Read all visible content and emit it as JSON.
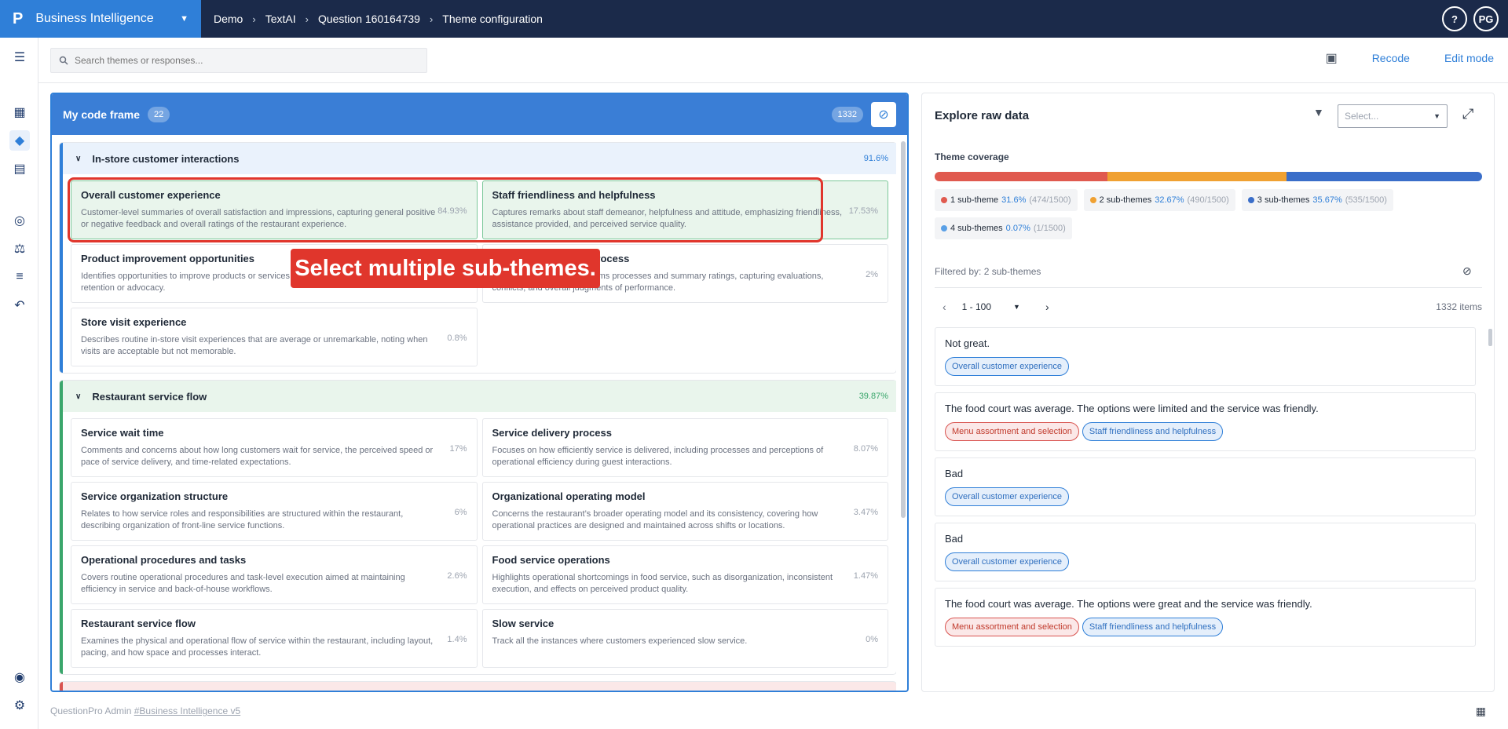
{
  "app": {
    "logo": "P",
    "name": "Business Intelligence"
  },
  "breadcrumb": [
    "Demo",
    "TextAI",
    "Question 160164739",
    "Theme configuration"
  ],
  "user": {
    "help": "?",
    "initials": "PG"
  },
  "search": {
    "placeholder": "Search themes or responses..."
  },
  "actions": {
    "recode": "Recode",
    "edit_mode": "Edit mode"
  },
  "codeframe": {
    "title": "My code frame",
    "count": "22",
    "total": "1332",
    "groups": [
      {
        "name": "In-store customer interactions",
        "pct": "91.6%",
        "cards": [
          {
            "title": "Overall customer experience",
            "desc": "Customer-level summaries of overall satisfaction and impressions, capturing general positive or negative feedback and overall ratings of the restaurant experience.",
            "pct": "84.93%"
          },
          {
            "title": "Staff friendliness and helpfulness",
            "desc": "Captures remarks about staff demeanor, helpfulness and attitude, emphasizing friendliness, assistance provided, and perceived service quality.",
            "pct": "17.53%"
          },
          {
            "title": "Product improvement opportunities",
            "desc": "Identifies opportunities to improve products or services, follow-up actions, and factors tied to retention or advocacy.",
            "pct": ""
          },
          {
            "title": "Program evaluation process",
            "desc": "Covers evaluation of programs processes and summary ratings, capturing evaluations, conflicts, and overall judgments of performance.",
            "pct": "2%"
          },
          {
            "title": "Store visit experience",
            "desc": "Describes routine in-store visit experiences that are average or unremarkable, noting when visits are acceptable but not memorable.",
            "pct": "0.8%"
          }
        ]
      },
      {
        "name": "Restaurant service flow",
        "pct": "39.87%",
        "cards": [
          {
            "title": "Service wait time",
            "desc": "Comments and concerns about how long customers wait for service, the perceived speed or pace of service delivery, and time-related expectations.",
            "pct": "17%"
          },
          {
            "title": "Service delivery process",
            "desc": "Focuses on how efficiently service is delivered, including processes and perceptions of operational efficiency during guest interactions.",
            "pct": "8.07%"
          },
          {
            "title": "Service organization structure",
            "desc": "Relates to how service roles and responsibilities are structured within the restaurant, describing organization of front-line service functions.",
            "pct": "6%"
          },
          {
            "title": "Organizational operating model",
            "desc": "Concerns the restaurant’s broader operating model and its consistency, covering how operational practices are designed and maintained across shifts or locations.",
            "pct": "3.47%"
          },
          {
            "title": "Operational procedures and tasks",
            "desc": "Covers routine operational procedures and task-level execution aimed at maintaining efficiency in service and back-of-house workflows.",
            "pct": "2.6%"
          },
          {
            "title": "Food service operations",
            "desc": "Highlights operational shortcomings in food service, such as disorganization, inconsistent execution, and effects on perceived product quality.",
            "pct": "1.47%"
          },
          {
            "title": "Restaurant service flow",
            "desc": "Examines the physical and operational flow of service within the restaurant, including layout, pacing, and how space and processes interact.",
            "pct": "1.4%"
          },
          {
            "title": "Slow service",
            "desc": "Track all the instances where customers experienced slow service.",
            "pct": "0%"
          }
        ]
      }
    ]
  },
  "callout": "Select multiple sub-themes.",
  "explore": {
    "title": "Explore raw data",
    "select_placeholder": "Select...",
    "coverage_label": "Theme coverage",
    "coverage": [
      {
        "label": "1 sub-theme",
        "pct": "31.6%",
        "count": "(474/1500)",
        "color": "#e05a4f",
        "share": 31.6
      },
      {
        "label": "2 sub-themes",
        "pct": "32.67%",
        "count": "(490/1500)",
        "color": "#f0a132",
        "share": 32.67
      },
      {
        "label": "3 sub-themes",
        "pct": "35.67%",
        "count": "(535/1500)",
        "color": "#3a6ec9",
        "share": 35.67
      },
      {
        "label": "4 sub-themes",
        "pct": "0.07%",
        "count": "(1/1500)",
        "color": "#5aa0e6",
        "share": 0.07
      }
    ],
    "filtered_by": "Filtered by: 2 sub-themes",
    "page_range": "1 - 100",
    "items": "1332 items",
    "responses": [
      {
        "text": "Not great.",
        "tags": [
          {
            "label": "Overall customer experience",
            "kind": "blue"
          }
        ]
      },
      {
        "text": "The food court was average. The options were limited and the service was friendly.",
        "tags": [
          {
            "label": "Menu assortment and selection",
            "kind": "red"
          },
          {
            "label": "Staff friendliness and helpfulness",
            "kind": "blue"
          }
        ]
      },
      {
        "text": "Bad",
        "tags": [
          {
            "label": "Overall customer experience",
            "kind": "blue"
          }
        ]
      },
      {
        "text": "Bad",
        "tags": [
          {
            "label": "Overall customer experience",
            "kind": "blue"
          }
        ]
      },
      {
        "text": "The food court was average. The options were great and the service was friendly.",
        "tags": [
          {
            "label": "Menu assortment and selection",
            "kind": "red"
          },
          {
            "label": "Staff friendliness and helpfulness",
            "kind": "blue"
          }
        ]
      }
    ]
  },
  "footer": {
    "prefix": "QuestionPro Admin ",
    "link": "#Business Intelligence v5"
  }
}
